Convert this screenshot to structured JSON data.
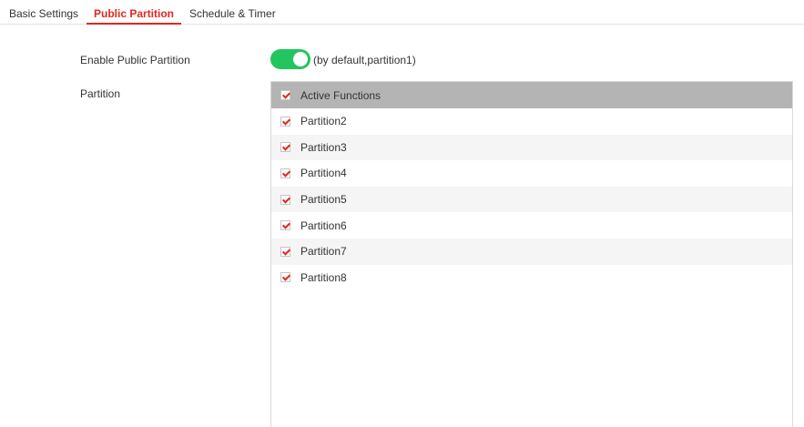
{
  "tabs": [
    {
      "label": "Basic Settings",
      "active": false
    },
    {
      "label": "Public Partition",
      "active": true
    },
    {
      "label": "Schedule & Timer",
      "active": false
    }
  ],
  "enable_public_partition": {
    "label": "Enable Public Partition",
    "enabled": true,
    "hint": "(by default,partition1)"
  },
  "partition": {
    "label": "Partition",
    "header": {
      "label": "Active Functions",
      "checked": true
    },
    "items": [
      {
        "label": "Partition2",
        "checked": true
      },
      {
        "label": "Partition3",
        "checked": true
      },
      {
        "label": "Partition4",
        "checked": true
      },
      {
        "label": "Partition5",
        "checked": true
      },
      {
        "label": "Partition6",
        "checked": true
      },
      {
        "label": "Partition7",
        "checked": true
      },
      {
        "label": "Partition8",
        "checked": true
      }
    ]
  },
  "colors": {
    "accent": "#e0281f",
    "toggle_on": "#22c55e",
    "header_bg": "#b4b4b4"
  }
}
